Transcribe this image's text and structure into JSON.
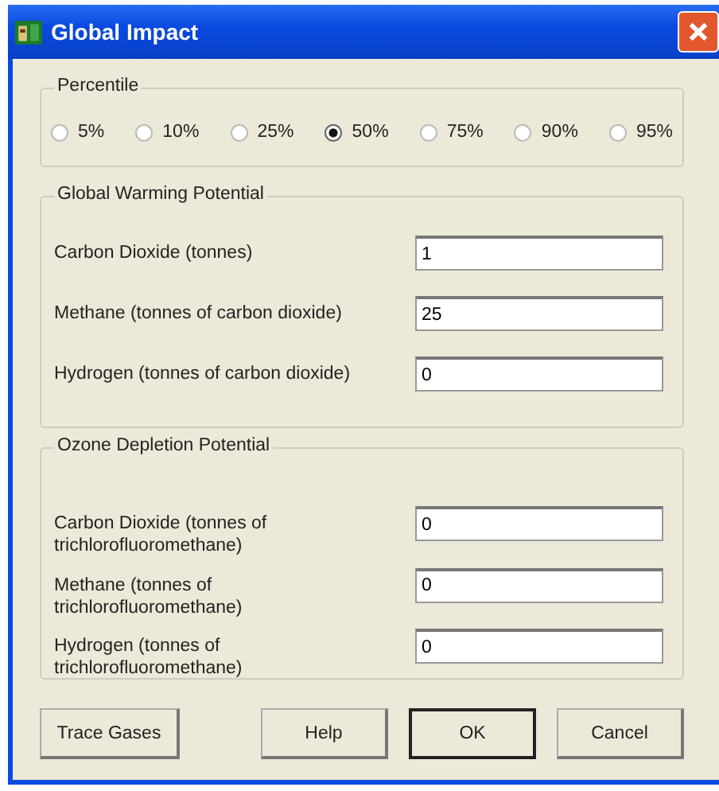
{
  "window": {
    "title": "Global Impact"
  },
  "percentile": {
    "label": "Percentile",
    "options": [
      {
        "label": "5%",
        "selected": false
      },
      {
        "label": "10%",
        "selected": false
      },
      {
        "label": "25%",
        "selected": false
      },
      {
        "label": "50%",
        "selected": true
      },
      {
        "label": "75%",
        "selected": false
      },
      {
        "label": "90%",
        "selected": false
      },
      {
        "label": "95%",
        "selected": false
      }
    ]
  },
  "groups": [
    {
      "title": "Global Warming Potential",
      "fields": [
        {
          "label": "Carbon Dioxide (tonnes)",
          "value": "1"
        },
        {
          "label": "Methane (tonnes of carbon dioxide)",
          "value": "25"
        },
        {
          "label": "Hydrogen (tonnes of carbon dioxide)",
          "value": "0"
        }
      ]
    },
    {
      "title": "Ozone Depletion Potential",
      "fields": [
        {
          "label": "Carbon Dioxide (tonnes of trichlorofluoromethane)",
          "value": "0"
        },
        {
          "label": "Methane (tonnes of trichlorofluoromethane)",
          "value": "0"
        },
        {
          "label": "Hydrogen (tonnes of trichlorofluoromethane)",
          "value": "0"
        }
      ]
    }
  ],
  "buttons": [
    {
      "label": "Trace Gases",
      "kind": "left"
    },
    {
      "label": "Help",
      "kind": "right"
    },
    {
      "label": "OK",
      "kind": "default"
    },
    {
      "label": "Cancel",
      "kind": "right"
    }
  ]
}
